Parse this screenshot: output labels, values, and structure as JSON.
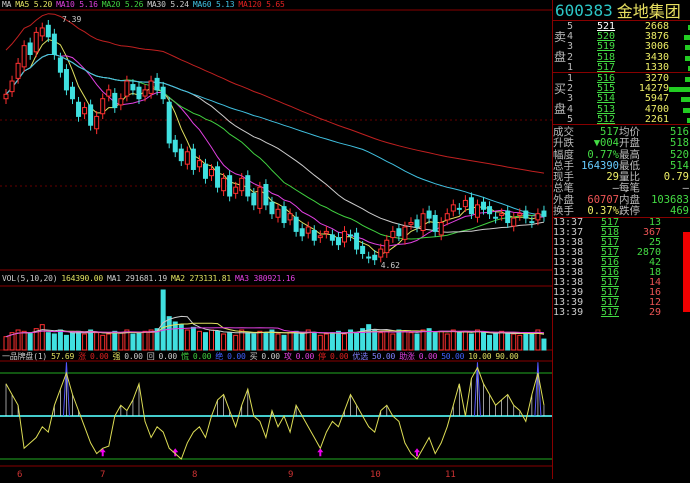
{
  "ma_legend": [
    {
      "t": "MA",
      "c": "#cccccc"
    },
    {
      "t": "MA5 5.20",
      "c": "#e0e060"
    },
    {
      "t": "MA10 5.16",
      "c": "#e040e0"
    },
    {
      "t": "MA20 5.26",
      "c": "#40d040"
    },
    {
      "t": "MA30 5.24",
      "c": "#cccccc"
    },
    {
      "t": "MA60 5.13",
      "c": "#40c0e0"
    },
    {
      "t": "MA120 5.65",
      "c": "#e02020"
    }
  ],
  "price_high_label": "7.39",
  "price_low_label": "4.62",
  "vol_legend": [
    {
      "t": "VOL(5,10,20)",
      "c": "#cccccc"
    },
    {
      "t": "164390.00",
      "c": "#e0e060"
    },
    {
      "t": "MA1 291681.19",
      "c": "#cccccc"
    },
    {
      "t": "MA2 273131.81",
      "c": "#e0e060"
    },
    {
      "t": "MA3 380921.16",
      "c": "#e040e0"
    }
  ],
  "ind_legend": [
    {
      "t": "一品牌盘(1)",
      "c": "#cccccc"
    },
    {
      "t": "57.69",
      "c": "#e0e060"
    },
    {
      "t": "涨",
      "c": "#e02020"
    },
    {
      "t": "0.00",
      "c": "#e02020"
    },
    {
      "t": "强",
      "c": "#e0e060"
    },
    {
      "t": "0.00",
      "c": "#cccccc"
    },
    {
      "t": "回",
      "c": "#cccccc"
    },
    {
      "t": "0.00",
      "c": "#cccccc"
    },
    {
      "t": "慌",
      "c": "#40d040"
    },
    {
      "t": "0.00",
      "c": "#40d040"
    },
    {
      "t": "绝",
      "c": "#4060ff"
    },
    {
      "t": "0.00",
      "c": "#4060ff"
    },
    {
      "t": "买",
      "c": "#cccccc"
    },
    {
      "t": "0.00",
      "c": "#cccccc"
    },
    {
      "t": "攻",
      "c": "#e040e0"
    },
    {
      "t": "0.00",
      "c": "#e040e0"
    },
    {
      "t": "停",
      "c": "#e02020"
    },
    {
      "t": "0.00",
      "c": "#e02020"
    },
    {
      "t": "优选",
      "c": "#8080ff"
    },
    {
      "t": "50.00",
      "c": "#8080ff"
    },
    {
      "t": "助涨",
      "c": "#e040e0"
    },
    {
      "t": "0.00",
      "c": "#e040e0"
    },
    {
      "t": "50.00",
      "c": "#4060ff"
    },
    {
      "t": "10.00",
      "c": "#e0e060"
    },
    {
      "t": "90.00",
      "c": "#e0e060"
    }
  ],
  "x_axis": [
    "6",
    "7",
    "8",
    "9",
    "10",
    "11"
  ],
  "closes": [
    6.55,
    6.7,
    6.9,
    7.1,
    7.0,
    7.25,
    7.3,
    7.2,
    7.0,
    6.8,
    6.6,
    6.5,
    6.3,
    6.4,
    6.2,
    6.3,
    6.5,
    6.6,
    6.4,
    6.5,
    6.7,
    6.6,
    6.5,
    6.6,
    6.7,
    6.6,
    6.5,
    6.0,
    5.9,
    5.8,
    5.9,
    5.7,
    5.8,
    5.6,
    5.7,
    5.5,
    5.6,
    5.4,
    5.5,
    5.6,
    5.4,
    5.3,
    5.5,
    5.3,
    5.2,
    5.25,
    5.1,
    5.2,
    5.0,
    4.95,
    5.05,
    4.9,
    4.95,
    5.0,
    4.9,
    4.85,
    5.0,
    4.95,
    4.8,
    4.75,
    4.7,
    4.68,
    4.8,
    4.9,
    5.0,
    4.95,
    5.05,
    5.1,
    5.05,
    5.2,
    5.15,
    5.0,
    5.1,
    5.2,
    5.3,
    5.25,
    5.35,
    5.2,
    5.3,
    5.25,
    5.2,
    5.15,
    5.2,
    5.1,
    5.15,
    5.2,
    5.15,
    5.1,
    5.2,
    5.17
  ],
  "volumes": [
    200,
    260,
    300,
    280,
    250,
    320,
    380,
    260,
    240,
    300,
    220,
    260,
    280,
    240,
    300,
    260,
    220,
    240,
    280,
    260,
    300,
    240,
    260,
    280,
    300,
    320,
    900,
    500,
    420,
    380,
    300,
    340,
    280,
    260,
    300,
    280,
    240,
    260,
    220,
    300,
    260,
    240,
    280,
    260,
    300,
    240,
    220,
    260,
    280,
    240,
    300,
    260,
    220,
    240,
    260,
    280,
    240,
    300,
    260,
    320,
    380,
    300,
    260,
    280,
    240,
    300,
    280,
    260,
    240,
    300,
    320,
    260,
    280,
    240,
    300,
    260,
    280,
    240,
    300,
    260,
    220,
    240,
    280,
    260,
    240,
    220,
    260,
    240,
    300,
    164
  ],
  "indicator": [
    80,
    70,
    60,
    20,
    25,
    30,
    40,
    35,
    60,
    75,
    90,
    70,
    55,
    40,
    25,
    15,
    20,
    22,
    50,
    60,
    55,
    65,
    80,
    45,
    30,
    40,
    35,
    20,
    15,
    10,
    25,
    35,
    40,
    30,
    50,
    65,
    70,
    55,
    40,
    60,
    75,
    50,
    45,
    30,
    55,
    40,
    50,
    35,
    60,
    50,
    40,
    30,
    20,
    35,
    45,
    40,
    55,
    70,
    60,
    50,
    40,
    35,
    55,
    60,
    50,
    45,
    25,
    15,
    10,
    20,
    30,
    15,
    25,
    40,
    60,
    80,
    50,
    85,
    95,
    80,
    70,
    60,
    65,
    70,
    60,
    55,
    45,
    70,
    90,
    60
  ],
  "quote": {
    "code": "600383",
    "name": "金地集团",
    "sell_label": "卖盘",
    "buy_label": "买盘",
    "sell": [
      {
        "n": "5",
        "p": "521",
        "v": "2668",
        "w": 5
      },
      {
        "n": "4",
        "p": "520",
        "v": "3876",
        "w": 16
      },
      {
        "n": "3",
        "p": "519",
        "v": "3006",
        "w": 12
      },
      {
        "n": "2",
        "p": "518",
        "v": "3430",
        "w": 14
      },
      {
        "n": "1",
        "p": "517",
        "v": "1330",
        "w": 5
      }
    ],
    "buy": [
      {
        "n": "1",
        "p": "516",
        "v": "3270",
        "w": 13
      },
      {
        "n": "2",
        "p": "515",
        "v": "14279",
        "w": 55
      },
      {
        "n": "3",
        "p": "514",
        "v": "5947",
        "w": 24
      },
      {
        "n": "4",
        "p": "513",
        "v": "4700",
        "w": 19
      },
      {
        "n": "5",
        "p": "512",
        "v": "2261",
        "w": 9
      }
    ],
    "stats": [
      {
        "l": "成交",
        "a": "517",
        "ac": "#4d4",
        "l2": "均价",
        "b": "516",
        "bc": "#4d4"
      },
      {
        "l": "升跌",
        "a": "▼004",
        "ac": "#4d4",
        "l2": "开盘",
        "b": "518",
        "bc": "#4d4"
      },
      {
        "l": "幅度",
        "a": "0.77%",
        "ac": "#4d4",
        "l2": "最高",
        "b": "520",
        "bc": "#4d4"
      },
      {
        "l": "总手",
        "a": "164390",
        "ac": "#6cf",
        "l2": "最低",
        "b": "514",
        "bc": "#4d4"
      },
      {
        "l": "现手",
        "a": "29",
        "ac": "#ee6",
        "l2": "量比",
        "b": "0.79",
        "bc": "#ee6"
      },
      {
        "l": "总笔",
        "a": "—",
        "ac": "#ccc",
        "l2": "每笔",
        "b": "—",
        "bc": "#ccc"
      },
      {
        "l": "外盘",
        "a": "60707",
        "ac": "#e55",
        "l2": "内盘",
        "b": "103683",
        "bc": "#4d4"
      },
      {
        "l": "换手",
        "a": "0.37%",
        "ac": "#ee6",
        "l2": "跌停",
        "b": "469",
        "bc": "#4d4"
      }
    ],
    "ticks": [
      {
        "t": "13:37",
        "p": "517",
        "v": "13",
        "c": "#4d4"
      },
      {
        "t": "13:37",
        "p": "518",
        "v": "367",
        "c": "#e55"
      },
      {
        "t": "13:38",
        "p": "517",
        "v": "25",
        "c": "#4d4"
      },
      {
        "t": "13:38",
        "p": "517",
        "v": "2870",
        "c": "#4d4"
      },
      {
        "t": "13:38",
        "p": "516",
        "v": "42",
        "c": "#4d4"
      },
      {
        "t": "13:38",
        "p": "516",
        "v": "18",
        "c": "#4d4"
      },
      {
        "t": "13:38",
        "p": "517",
        "v": "14",
        "c": "#e55"
      },
      {
        "t": "13:39",
        "p": "517",
        "v": "16",
        "c": "#e55"
      },
      {
        "t": "13:39",
        "p": "517",
        "v": "12",
        "c": "#e55"
      },
      {
        "t": "13:39",
        "p": "517",
        "v": "29",
        "c": "#e55"
      }
    ]
  }
}
